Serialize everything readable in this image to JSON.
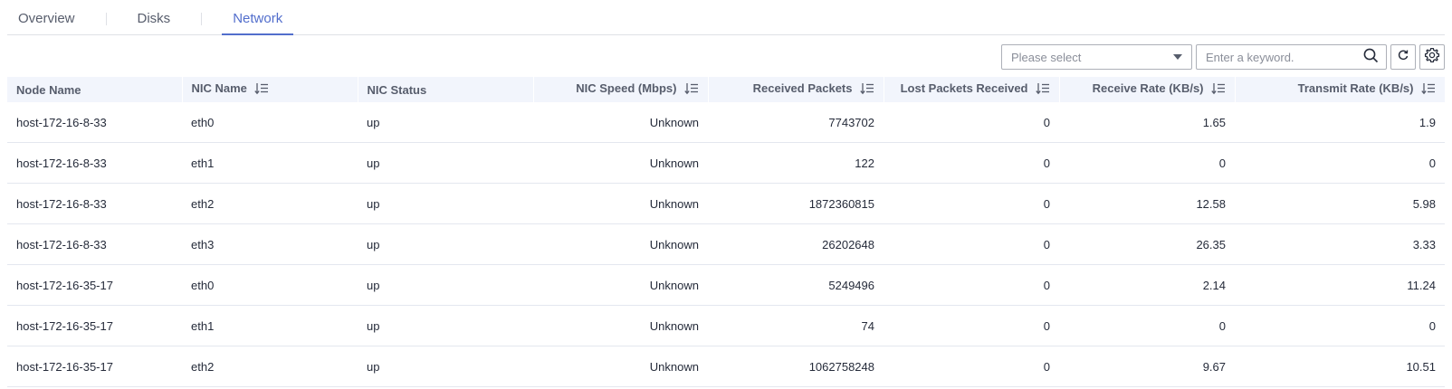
{
  "tabs": [
    {
      "label": "Overview",
      "active": false
    },
    {
      "label": "Disks",
      "active": false
    },
    {
      "label": "Network",
      "active": true
    }
  ],
  "toolbar": {
    "select_placeholder": "Please select",
    "search_placeholder": "Enter a keyword.",
    "search_icon": "search-icon",
    "refresh_icon": "refresh-icon",
    "settings_icon": "gear-icon"
  },
  "table": {
    "columns": [
      {
        "label": "Node Name",
        "sortable": false
      },
      {
        "label": "NIC Name",
        "sortable": true
      },
      {
        "label": "NIC Status",
        "sortable": false
      },
      {
        "label": "NIC Speed (Mbps)",
        "sortable": true
      },
      {
        "label": "Received Packets",
        "sortable": true
      },
      {
        "label": "Lost Packets Received",
        "sortable": true
      },
      {
        "label": "Receive Rate (KB/s)",
        "sortable": true
      },
      {
        "label": "Transmit Rate (KB/s)",
        "sortable": true
      }
    ],
    "rows": [
      [
        "host-172-16-8-33",
        "eth0",
        "up",
        "Unknown",
        "7743702",
        "0",
        "1.65",
        "1.9"
      ],
      [
        "host-172-16-8-33",
        "eth1",
        "up",
        "Unknown",
        "122",
        "0",
        "0",
        "0"
      ],
      [
        "host-172-16-8-33",
        "eth2",
        "up",
        "Unknown",
        "1872360815",
        "0",
        "12.58",
        "5.98"
      ],
      [
        "host-172-16-8-33",
        "eth3",
        "up",
        "Unknown",
        "26202648",
        "0",
        "26.35",
        "3.33"
      ],
      [
        "host-172-16-35-17",
        "eth0",
        "up",
        "Unknown",
        "5249496",
        "0",
        "2.14",
        "11.24"
      ],
      [
        "host-172-16-35-17",
        "eth1",
        "up",
        "Unknown",
        "74",
        "0",
        "0",
        "0"
      ],
      [
        "host-172-16-35-17",
        "eth2",
        "up",
        "Unknown",
        "1062758248",
        "0",
        "9.67",
        "10.51"
      ]
    ]
  },
  "colors": {
    "accent": "#526ecc",
    "header_bg": "#f2f5fc",
    "row_border": "#e4e7ef"
  }
}
